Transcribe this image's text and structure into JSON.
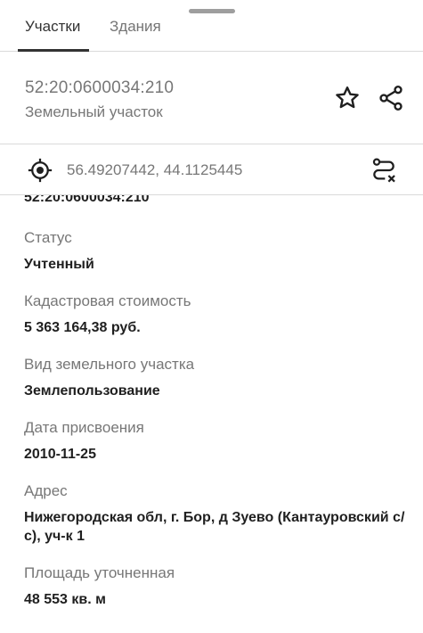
{
  "tabs": [
    {
      "label": "Участки"
    },
    {
      "label": "Здания"
    }
  ],
  "parcel": {
    "cadastral_number": "52:20:0600034:210",
    "type": "Земельный участок"
  },
  "coordinates": {
    "text": "56.49207442, 44.1125445"
  },
  "details": {
    "scrolled_value": "52:20:0600034:210",
    "fields": [
      {
        "label": "Статус",
        "value": "Учтенный"
      },
      {
        "label": "Кадастровая стоимость",
        "value": "5 363 164,38 руб."
      },
      {
        "label": "Вид земельного участка",
        "value": "Землепользование"
      },
      {
        "label": "Дата присвоения",
        "value": "2010-11-25"
      },
      {
        "label": "Адрес",
        "value": "Нижегородская обл, г. Бор, д Зуево (Кантауровский с/с), уч-к 1"
      },
      {
        "label": "Площадь уточненная",
        "value": "48 553 кв. м"
      }
    ]
  },
  "icons": {
    "star": "star-outline-icon",
    "share": "share-icon",
    "target": "gps-target-icon",
    "route": "route-clear-icon"
  }
}
